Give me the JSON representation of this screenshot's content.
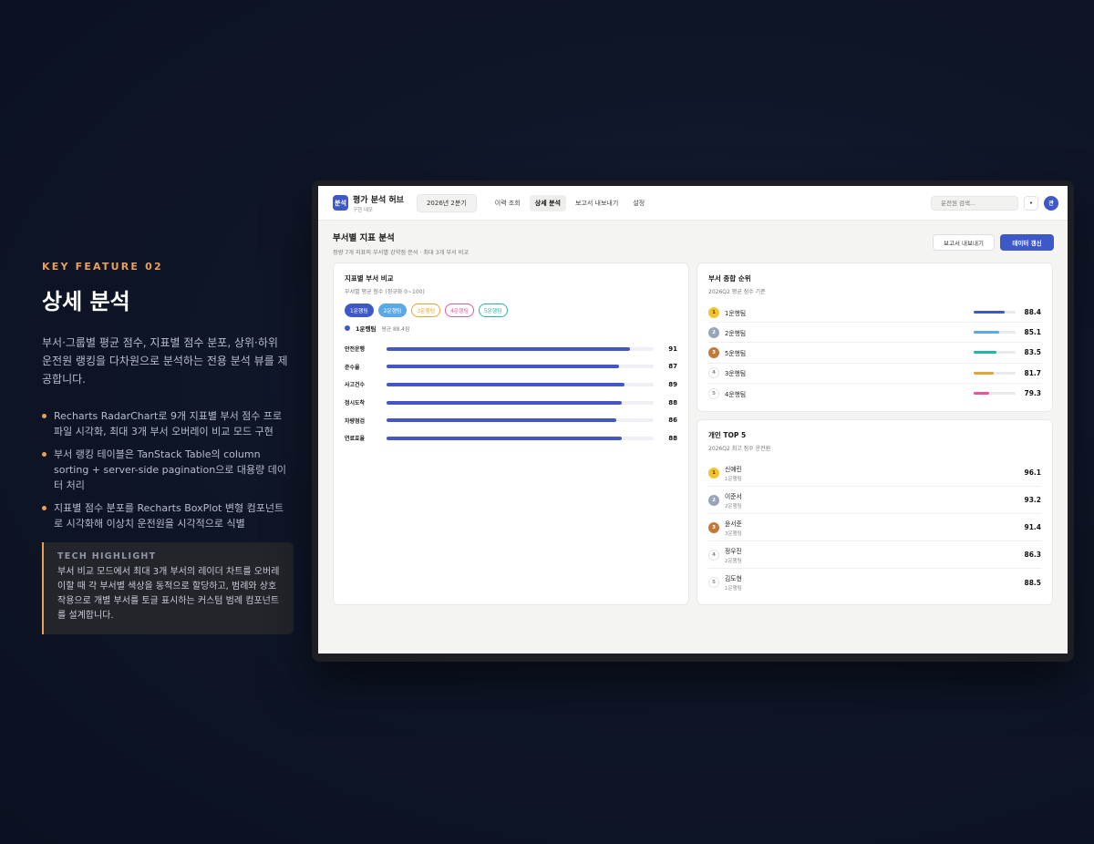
{
  "feature": {
    "kicker": "KEY FEATURE 02",
    "title": "상세 분석",
    "description": "부서·그룹별 평균 점수, 지표별 점수 분포, 상위·하위 운전원 랭킹을 다차원으로 분석하는 전용 분석 뷰를 제공합니다.",
    "bullets": [
      "Recharts RadarChart로 9개 지표별 부서 점수 프로파일 시각화, 최대 3개 부서 오버레이 비교 모드 구현",
      "부서 랭킹 테이블은 TanStack Table의 column sorting + server-side pagination으로 대용량 데이터 처리",
      "지표별 점수 분포를 Recharts BoxPlot 변형 컴포넌트로 시각화해 이상치 운전원을 시각적으로 식별"
    ],
    "tech_title": "TECH HIGHLIGHT",
    "tech_body": "부서 비교 모드에서 최대 3개 부서의 레이더 차트를 오버레이할 때 각 부서별 색상을 동적으로 할당하고, 범례와 상호작용으로 개별 부서를 토글 표시하는 커스텀 범례 컴포넌트를 설계합니다."
  },
  "app": {
    "logo_text": "분석",
    "brand_name": "평가 분석 허브",
    "brand_sub": "구현 데모",
    "period": "2026년 2분기",
    "nav": [
      "이력 조회",
      "상세 분석",
      "보고서 내보내기",
      "설정"
    ],
    "search_placeholder": "운전원 검색...",
    "bell_icon": "•",
    "avatar_text": "관"
  },
  "page": {
    "title": "부서별 지표 분석",
    "subtitle": "정량 7개 지표의 부서별 강약점 분석 · 최대 3개 부서 비교",
    "export_label": "보고서 내보내기",
    "refresh_label": "데이터 갱신"
  },
  "compare": {
    "title": "지표별 부서 비교",
    "subtitle": "부서별 평균 점수 (정규화 0~100)",
    "chips": [
      {
        "label": "1운행팀",
        "color": "#3f58c8",
        "active": true
      },
      {
        "label": "2운행팀",
        "color": "#5aa9e6",
        "active": true
      },
      {
        "label": "3운행팀",
        "color": "#e3a62f",
        "active": false
      },
      {
        "label": "4운행팀",
        "color": "#e0579b",
        "active": false
      },
      {
        "label": "5운행팀",
        "color": "#22b8a7",
        "active": false
      }
    ],
    "legend_name": "1운행팀",
    "legend_avg": "평균 88.4점",
    "rows": [
      {
        "label": "안전운행",
        "value": 91
      },
      {
        "label": "준수율",
        "value": 87
      },
      {
        "label": "사고건수",
        "value": 89
      },
      {
        "label": "정시도착",
        "value": 88
      },
      {
        "label": "차량점검",
        "value": 86
      },
      {
        "label": "연료효율",
        "value": 88
      }
    ]
  },
  "ranking": {
    "title": "부서 종합 순위",
    "subtitle": "2026Q2 평균 점수 기준",
    "rows": [
      {
        "rank": "1",
        "name": "1운행팀",
        "score": "88.4",
        "color": "#3f58c8"
      },
      {
        "rank": "2",
        "name": "2운행팀",
        "score": "85.1",
        "color": "#5aa9e6"
      },
      {
        "rank": "3",
        "name": "5운행팀",
        "score": "83.5",
        "color": "#22b8a7"
      },
      {
        "rank": "4",
        "name": "3운행팀",
        "score": "81.7",
        "color": "#e3a62f"
      },
      {
        "rank": "5",
        "name": "4운행팀",
        "score": "79.3",
        "color": "#e0579b"
      }
    ]
  },
  "top5": {
    "title": "개인 TOP 5",
    "subtitle": "2026Q2 최고 점수 운전원",
    "rows": [
      {
        "rank": "1",
        "name": "신예린",
        "team": "1운행팀",
        "score": "96.1"
      },
      {
        "rank": "2",
        "name": "이준서",
        "team": "2운행팀",
        "score": "93.2"
      },
      {
        "rank": "3",
        "name": "윤서준",
        "team": "3운행팀",
        "score": "91.4"
      },
      {
        "rank": "4",
        "name": "정우진",
        "team": "2운행팀",
        "score": "86.3"
      },
      {
        "rank": "5",
        "name": "김도현",
        "team": "1운행팀",
        "score": "88.5"
      }
    ]
  }
}
